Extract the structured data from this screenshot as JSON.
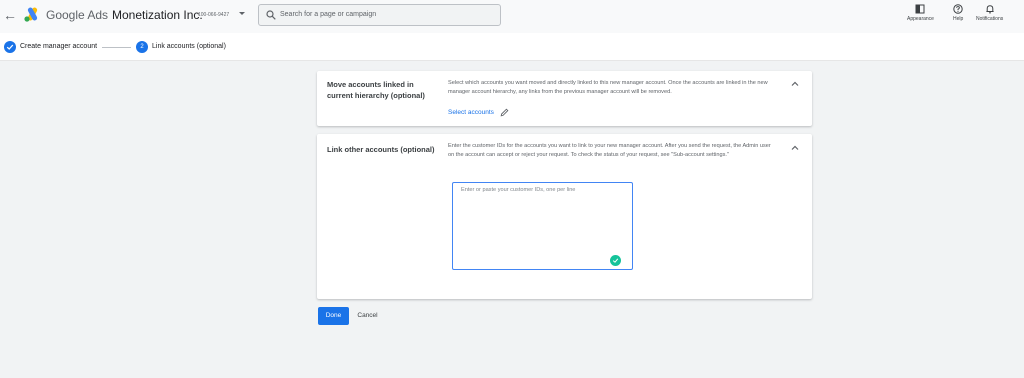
{
  "header": {
    "back_icon": "arrow-left-icon",
    "logo_icon": "google-ads-logo",
    "brand": "Google Ads",
    "account_name": "Monetization Inc.",
    "account_id": "100-066-9427",
    "search_placeholder": "Search for a page or campaign",
    "tools": [
      {
        "label": "Appearance",
        "icon": "appearance-icon"
      },
      {
        "label": "Help",
        "icon": "help-icon"
      },
      {
        "label": "Notifications",
        "icon": "bell-icon"
      }
    ]
  },
  "steps": [
    {
      "label": "Create manager account",
      "state": "complete"
    },
    {
      "number": "2",
      "label": "Link accounts (optional)",
      "state": "current"
    }
  ],
  "section_move": {
    "title": "Move accounts linked in current hierarchy (optional)",
    "description": "Select which accounts you want moved and directly linked to this new manager account. Once the accounts are linked in the new manager account hierarchy, any links from the previous manager account will be removed.",
    "link": "Select accounts"
  },
  "section_link": {
    "title": "Link other accounts (optional)",
    "description": "Enter the customer IDs for the accounts you want to link to your new manager account. After you send the request, the Admin user on the account can accept or reject your request. To check the status of your request, see \"Sub-account settings.\"",
    "placeholder": "Enter or paste your customer IDs, one per line",
    "value": ""
  },
  "actions": {
    "done": "Done",
    "cancel": "Cancel"
  },
  "colors": {
    "accent": "#1a73e8",
    "grammar_badge": "#15c39a"
  }
}
